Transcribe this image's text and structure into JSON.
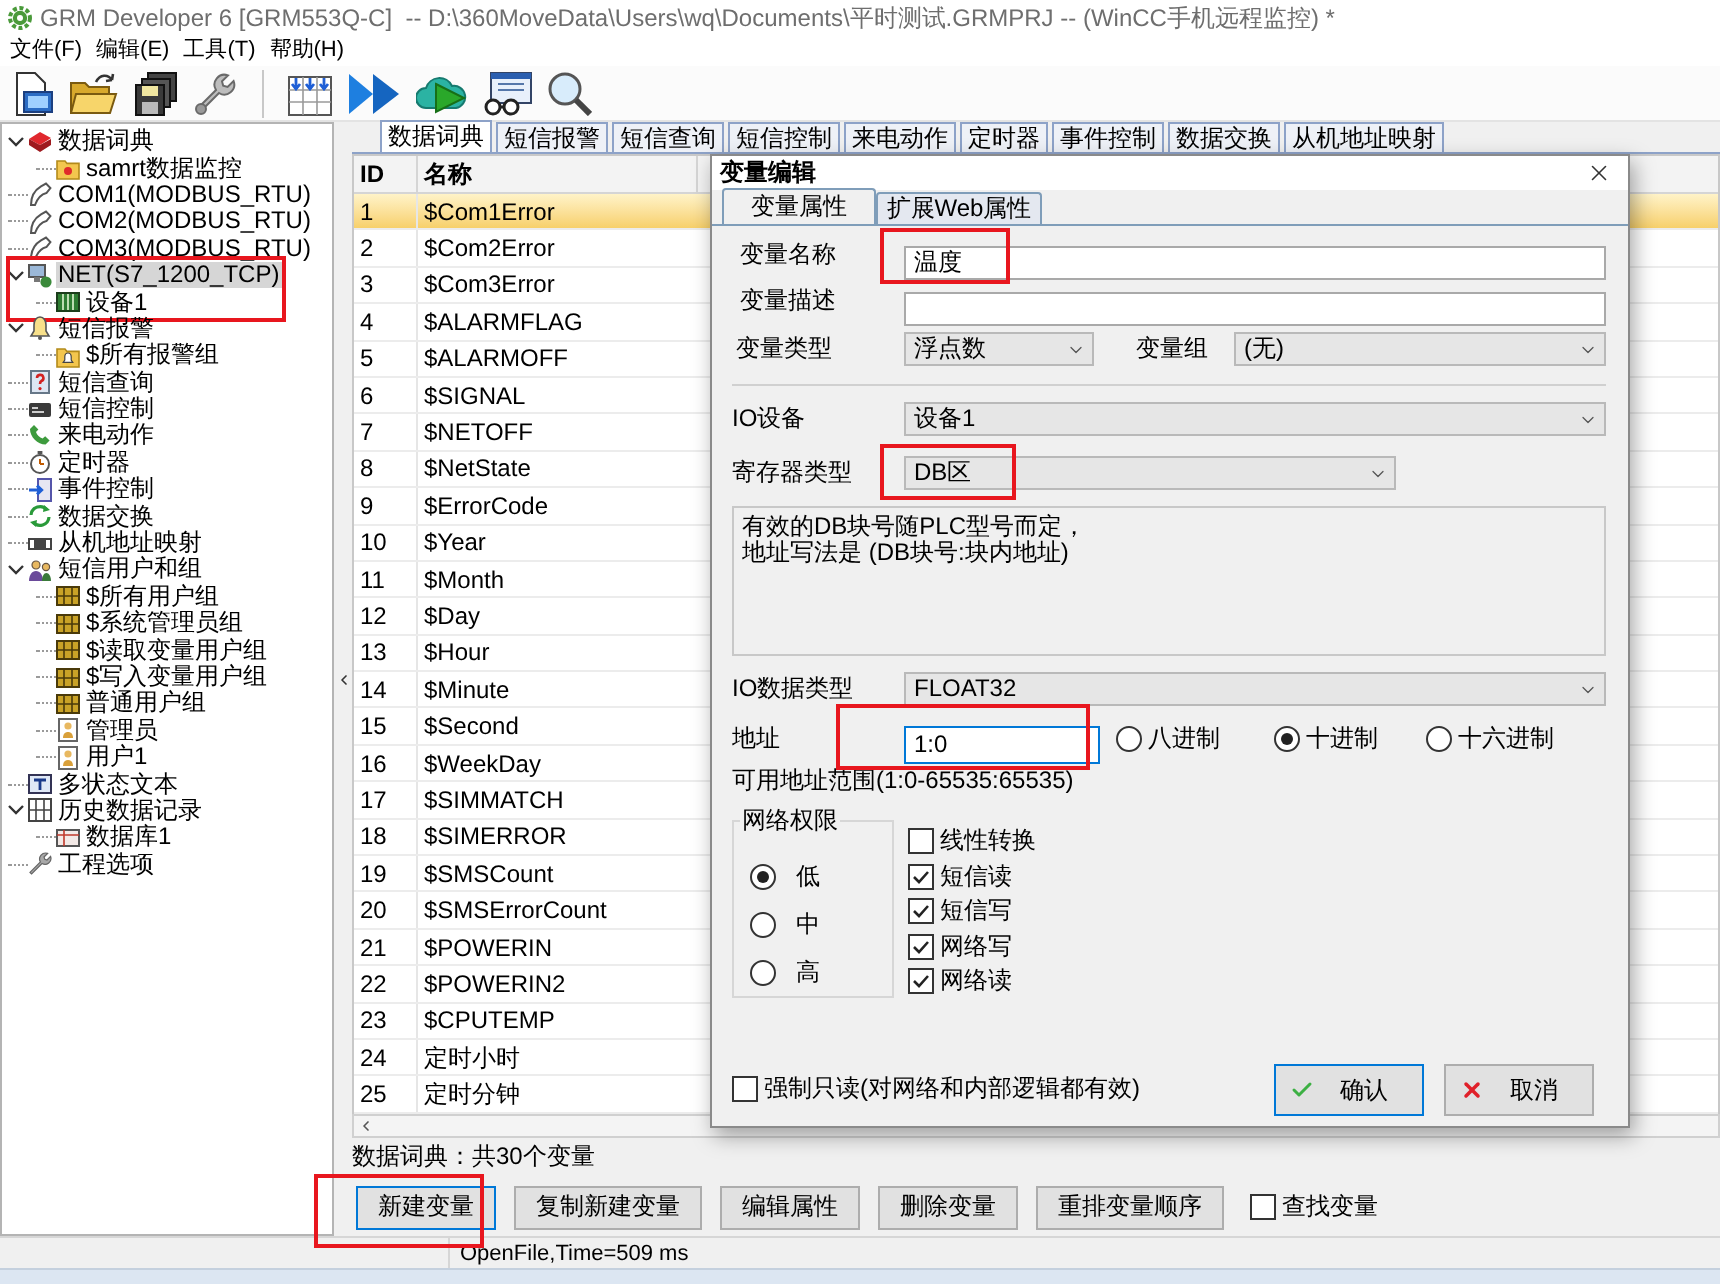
{
  "window": {
    "title": "GRM Developer 6 [GRM553Q-C]  -- D:\\360MoveData\\Users\\wq\\Documents\\平时测试.GRMPRJ -- (WinCC手机远程监控) *"
  },
  "menu": [
    "文件(F)",
    "编辑(E)",
    "工具(T)",
    "帮助(H)"
  ],
  "tree": [
    {
      "label": "数据词典",
      "kind": "dictionary",
      "expanded": true,
      "selected": false,
      "highlighted": false,
      "children": [
        {
          "label": "samrt数据监控",
          "kind": "folder",
          "selected": false,
          "highlighted": false
        }
      ]
    },
    {
      "label": "COM1(MODBUS_RTU)",
      "kind": "port",
      "selected": false,
      "highlighted": false
    },
    {
      "label": "COM2(MODBUS_RTU)",
      "kind": "port",
      "selected": false,
      "highlighted": false
    },
    {
      "label": "COM3(MODBUS_RTU)",
      "kind": "port",
      "selected": false,
      "highlighted": false
    },
    {
      "label": "NET(S7_1200_TCP)",
      "kind": "network",
      "expanded": true,
      "selected": true,
      "highlighted": true,
      "children": [
        {
          "label": "设备1",
          "kind": "device",
          "selected": false,
          "highlighted": false
        }
      ]
    },
    {
      "label": "短信报警",
      "kind": "alarm",
      "expanded": true,
      "selected": false,
      "highlighted": false,
      "children": [
        {
          "label": "$所有报警组",
          "kind": "alarm-group",
          "selected": false,
          "highlighted": false
        }
      ]
    },
    {
      "label": "短信查询",
      "kind": "query",
      "selected": false,
      "highlighted": false
    },
    {
      "label": "短信控制",
      "kind": "control",
      "selected": false,
      "highlighted": false
    },
    {
      "label": "来电动作",
      "kind": "call",
      "selected": false,
      "highlighted": false
    },
    {
      "label": "定时器",
      "kind": "timer",
      "selected": false,
      "highlighted": false
    },
    {
      "label": "事件控制",
      "kind": "event",
      "selected": false,
      "highlighted": false
    },
    {
      "label": "数据交换",
      "kind": "exchange",
      "selected": false,
      "highlighted": false
    },
    {
      "label": "从机地址映射",
      "kind": "mapping",
      "selected": false,
      "highlighted": false
    },
    {
      "label": "短信用户和组",
      "kind": "users",
      "expanded": true,
      "selected": false,
      "highlighted": false,
      "children": [
        {
          "label": "$所有用户组",
          "kind": "user-group",
          "selected": false,
          "highlighted": false
        },
        {
          "label": "$系统管理员组",
          "kind": "user-group",
          "selected": false,
          "highlighted": false
        },
        {
          "label": "$读取变量用户组",
          "kind": "user-group",
          "selected": false,
          "highlighted": false
        },
        {
          "label": "$写入变量用户组",
          "kind": "user-group",
          "selected": false,
          "highlighted": false
        },
        {
          "label": "普通用户组",
          "kind": "user-group",
          "selected": false,
          "highlighted": false
        },
        {
          "label": "管理员",
          "kind": "user",
          "selected": false,
          "highlighted": false
        },
        {
          "label": "用户1",
          "kind": "user",
          "selected": false,
          "highlighted": false
        }
      ]
    },
    {
      "label": "多状态文本",
      "kind": "text",
      "selected": false,
      "highlighted": false
    },
    {
      "label": "历史数据记录",
      "kind": "history",
      "expanded": true,
      "selected": false,
      "highlighted": false,
      "children": [
        {
          "label": "数据库1",
          "kind": "database",
          "selected": false,
          "highlighted": false
        }
      ]
    },
    {
      "label": "工程选项",
      "kind": "options",
      "selected": false,
      "highlighted": false
    }
  ],
  "tabs": [
    {
      "label": "数据词典",
      "selected": true
    },
    {
      "label": "短信报警",
      "selected": false
    },
    {
      "label": "短信查询",
      "selected": false
    },
    {
      "label": "短信控制",
      "selected": false
    },
    {
      "label": "来电动作",
      "selected": false
    },
    {
      "label": "定时器",
      "selected": false
    },
    {
      "label": "事件控制",
      "selected": false
    },
    {
      "label": "数据交换",
      "selected": false
    },
    {
      "label": "从机地址映射",
      "selected": false
    }
  ],
  "table": {
    "columns": [
      "ID",
      "名称"
    ],
    "rows": [
      {
        "id": "1",
        "name": "$Com1Error",
        "selected": true
      },
      {
        "id": "2",
        "name": "$Com2Error",
        "selected": false
      },
      {
        "id": "3",
        "name": "$Com3Error",
        "selected": false
      },
      {
        "id": "4",
        "name": "$ALARMFLAG",
        "selected": false
      },
      {
        "id": "5",
        "name": "$ALARMOFF",
        "selected": false
      },
      {
        "id": "6",
        "name": "$SIGNAL",
        "selected": false
      },
      {
        "id": "7",
        "name": "$NETOFF",
        "selected": false
      },
      {
        "id": "8",
        "name": "$NetState",
        "selected": false
      },
      {
        "id": "9",
        "name": "$ErrorCode",
        "selected": false
      },
      {
        "id": "10",
        "name": "$Year",
        "selected": false
      },
      {
        "id": "11",
        "name": "$Month",
        "selected": false
      },
      {
        "id": "12",
        "name": "$Day",
        "selected": false
      },
      {
        "id": "13",
        "name": "$Hour",
        "selected": false
      },
      {
        "id": "14",
        "name": "$Minute",
        "selected": false
      },
      {
        "id": "15",
        "name": "$Second",
        "selected": false
      },
      {
        "id": "16",
        "name": "$WeekDay",
        "selected": false
      },
      {
        "id": "17",
        "name": "$SIMMATCH",
        "selected": false
      },
      {
        "id": "18",
        "name": "$SIMERROR",
        "selected": false
      },
      {
        "id": "19",
        "name": "$SMSCount",
        "selected": false
      },
      {
        "id": "20",
        "name": "$SMSErrorCount",
        "selected": false
      },
      {
        "id": "21",
        "name": "$POWERIN",
        "selected": false
      },
      {
        "id": "22",
        "name": "$POWERIN2",
        "selected": false
      },
      {
        "id": "23",
        "name": "$CPUTEMP",
        "selected": false
      },
      {
        "id": "24",
        "name": "定时小时",
        "selected": false
      },
      {
        "id": "25",
        "name": "定时分钟",
        "selected": false
      }
    ]
  },
  "summary": "数据词典：共30个变量",
  "buttons": [
    {
      "label": "新建变量",
      "focused": true,
      "highlighted": true
    },
    {
      "label": "复制新建变量",
      "focused": false,
      "highlighted": false
    },
    {
      "label": "编辑属性",
      "focused": false,
      "highlighted": false
    },
    {
      "label": "删除变量",
      "focused": false,
      "highlighted": false
    },
    {
      "label": "重排变量顺序",
      "focused": false,
      "highlighted": false
    }
  ],
  "find_checkbox": {
    "label": "查找变量",
    "checked": false
  },
  "status_bar": "OpenFile,Time=509 ms",
  "dialog": {
    "title": "变量编辑",
    "tabs": [
      {
        "label": "变量属性",
        "selected": true
      },
      {
        "label": "扩展Web属性",
        "selected": false
      }
    ],
    "name": {
      "label": "变量名称",
      "value": "温度",
      "highlighted": true
    },
    "description": {
      "label": "变量描述"
    },
    "var_type": {
      "label": "变量类型",
      "value": "浮点数"
    },
    "var_group": {
      "label": "变量组",
      "value": "(无)"
    },
    "io_device": {
      "label": "IO设备",
      "value": "设备1"
    },
    "register_type": {
      "label": "寄存器类型",
      "value": "DB区",
      "highlighted": true
    },
    "note_lines": [
      "有效的DB块号随PLC型号而定，",
      "地址写法是 (DB块号:块内地址)"
    ],
    "io_data_type": {
      "label": "IO数据类型",
      "value": "FLOAT32"
    },
    "address": {
      "label": "地址",
      "value": "1:0",
      "focused": true,
      "highlighted": true
    },
    "radix": [
      {
        "label": "八进制",
        "selected": false
      },
      {
        "label": "十进制",
        "selected": true
      },
      {
        "label": "十六进制",
        "selected": false
      }
    ],
    "address_range": "可用地址范围(1:0-65535:65535)",
    "permission": {
      "title": "网络权限",
      "options": [
        {
          "label": "低",
          "selected": true
        },
        {
          "label": "中",
          "selected": false
        },
        {
          "label": "高",
          "selected": false
        }
      ]
    },
    "options": [
      {
        "label": "线性转换",
        "checked": false
      },
      {
        "label": "短信读",
        "checked": true
      },
      {
        "label": "短信写",
        "checked": true
      },
      {
        "label": "网络写",
        "checked": true
      },
      {
        "label": "网络读",
        "checked": true
      }
    ],
    "read_only": {
      "label": "强制只读(对网络和内部逻辑都有效)",
      "checked": false
    },
    "buttons": [
      {
        "label": "确认",
        "kind": "ok",
        "default": true
      },
      {
        "label": "取消",
        "kind": "cancel",
        "default": false
      }
    ]
  }
}
